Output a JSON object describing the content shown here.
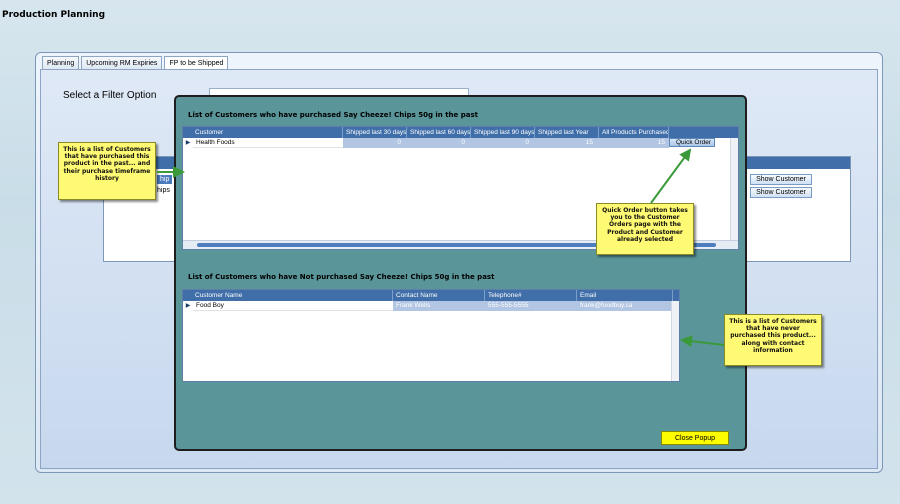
{
  "app": {
    "title": "Production Planning"
  },
  "tabs": [
    {
      "label": "Planning"
    },
    {
      "label": "Upcoming RM Expiries"
    },
    {
      "label": "FP to be Shipped"
    }
  ],
  "filter": {
    "label": "Select a Filter Option"
  },
  "background_grid": {
    "chip_text": "hip",
    "chips_text": "hips",
    "show_customer_label": "Show Customer"
  },
  "popup": {
    "purchased_heading": "List of Customers who have purchased Say Cheeze! Chips 50g in the past",
    "purchased_grid": {
      "columns": [
        "Customer",
        "Shipped last 30 days",
        "Shipped last 60 days",
        "Shipped last 90 days",
        "Shipped last Year",
        "All Products Purchased"
      ],
      "rows": [
        {
          "customer": "Health Foods",
          "d30": "0",
          "d60": "0",
          "d90": "0",
          "year": "15",
          "all": "15",
          "action": "Quick Order"
        }
      ]
    },
    "not_purchased_heading": "List of Customers who have Not purchased Say Cheeze! Chips 50g in the past",
    "not_purchased_grid": {
      "columns": [
        "Customer Name",
        "Contact Name",
        "Telephone#",
        "Email"
      ],
      "rows": [
        {
          "customer": "Food Boy",
          "contact": "Frank Wells",
          "phone": "555-555-5555",
          "email": "frank@foodboy.ca"
        }
      ]
    },
    "close_label": "Close Popup"
  },
  "callouts": {
    "left": "This is a list of Customers that have purchased this product in the past... and their purchase timeframe history",
    "quick_order": "Quick Order button takes you to the Customer Orders page with the Product and Customer already selected",
    "right": "This is a list of Customers that have never purchased this product... along with contact information"
  },
  "colors": {
    "popup_bg": "#5a9699",
    "grid_header": "#3f6ea8",
    "callout_bg": "#fffa73",
    "close_button": "#fdfd00",
    "arrow": "#3a9a3a"
  }
}
